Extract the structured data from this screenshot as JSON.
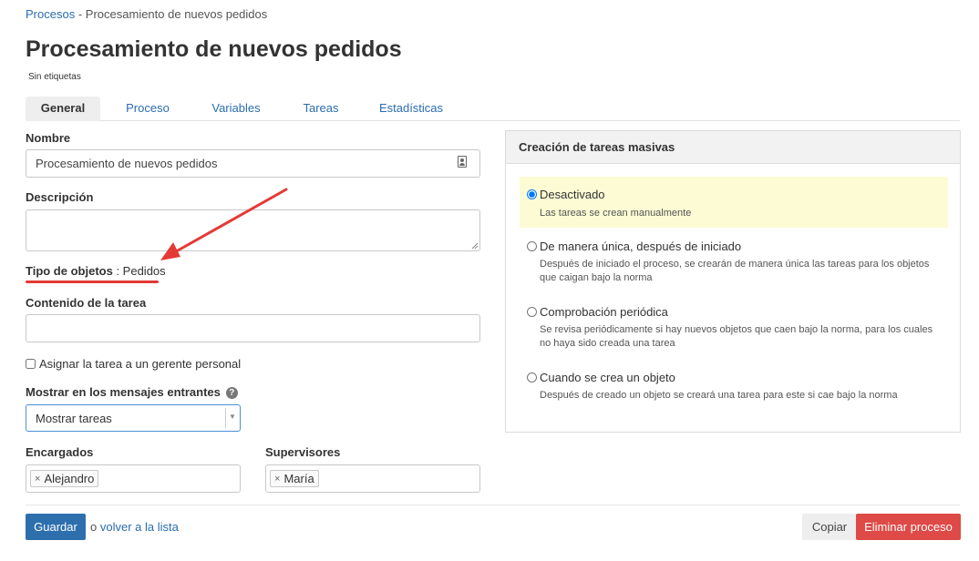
{
  "breadcrumb": {
    "parent": "Procesos",
    "separator": "-",
    "current": "Procesamiento de nuevos pedidos"
  },
  "page": {
    "title": "Procesamiento de nuevos pedidos",
    "tags_note": "Sin etiquetas"
  },
  "tabs": [
    {
      "label": "General",
      "active": true
    },
    {
      "label": "Proceso"
    },
    {
      "label": "Variables"
    },
    {
      "label": "Tareas"
    },
    {
      "label": "Estadísticas"
    }
  ],
  "form": {
    "name_label": "Nombre",
    "name_value": "Procesamiento de nuevos pedidos",
    "description_label": "Descripción",
    "description_value": "",
    "object_type_label": "Tipo de objetos",
    "object_type_sep": " : ",
    "object_type_value": "Pedidos",
    "task_content_label": "Contenido de la tarea",
    "task_content_value": "",
    "assign_manager_label": "Asignar la tarea a un gerente personal",
    "assign_manager_checked": false,
    "incoming_label": "Mostrar en los mensajes entrantes",
    "incoming_help": "?",
    "incoming_value": "Mostrar tareas",
    "assignees_label": "Encargados",
    "assignees": [
      "Alejandro"
    ],
    "supervisors_label": "Supervisores",
    "supervisors": [
      "María"
    ],
    "chip_remove": "×"
  },
  "mass_tasks": {
    "title": "Creación de tareas masivas",
    "options": [
      {
        "label": "Desactivado",
        "desc": "Las tareas se crean manualmente",
        "selected": true
      },
      {
        "label": "De manera única, después de iniciado",
        "desc": "Después de iniciado el proceso, se crearán de manera única las tareas para los objetos que caigan bajo la norma",
        "selected": false
      },
      {
        "label": "Comprobación periódica",
        "desc": "Se revisa periódicamente si hay nuevos objetos que caen bajo la norma, para los cuales no haya sido creada una tarea",
        "selected": false
      },
      {
        "label": "Cuando se crea un objeto",
        "desc": "Después de creado un objeto se creará una tarea para este si cae bajo la norma",
        "selected": false
      }
    ]
  },
  "footer": {
    "save_label": "Guardar",
    "or_text": "o",
    "back_link": "volver a la lista",
    "copy_label": "Copiar",
    "delete_label": "Eliminar proceso"
  },
  "colors": {
    "link": "#2a6db0",
    "primary": "#2d6fad",
    "danger": "#dd4a47",
    "highlight": "#fcfbd4",
    "annotation": "#e53935"
  },
  "icons": {
    "name_field": "contact-card-icon",
    "help": "help-icon",
    "caret": "chevron-down-icon",
    "remove": "close-icon"
  }
}
